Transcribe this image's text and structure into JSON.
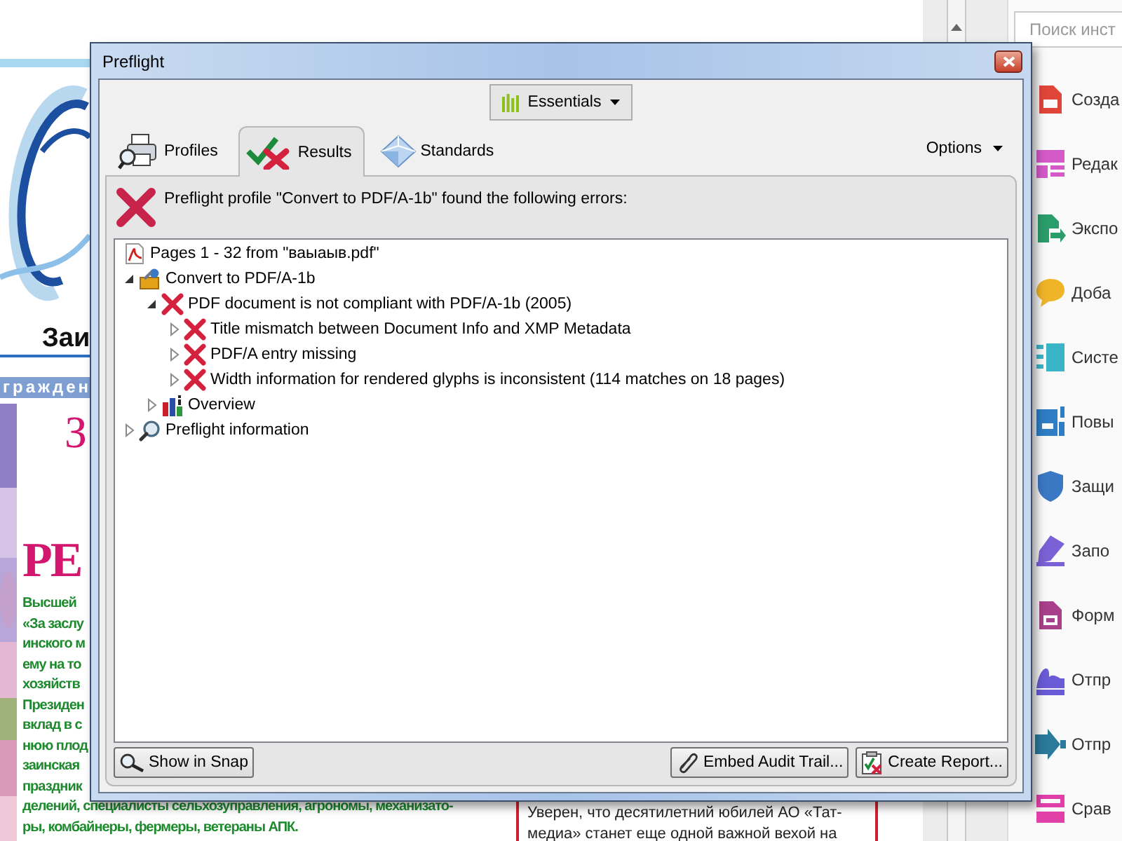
{
  "window": {
    "title": "Preflight"
  },
  "toolbar": {
    "profile_button": "Essentials"
  },
  "tabs": [
    {
      "label": "Profiles",
      "kind": "profiles",
      "selected": false
    },
    {
      "label": "Results",
      "kind": "results",
      "selected": true
    },
    {
      "label": "Standards",
      "kind": "standards",
      "selected": false
    }
  ],
  "options_menu": "Options",
  "results": {
    "message": "Preflight profile \"Convert to PDF/A-1b\" found the following errors:",
    "tree": [
      {
        "label": "Pages 1 - 32 from \"ваыаыв.pdf\"",
        "kind": "pdf"
      },
      {
        "label": "Convert to PDF/A-1b",
        "kind": "profile",
        "expanded": true,
        "children": [
          {
            "label": "PDF document is not compliant with PDF/A-1b (2005)",
            "kind": "error",
            "expanded": true,
            "children": [
              {
                "label": "Title mismatch between Document Info and XMP Metadata",
                "kind": "error",
                "expanded": false
              },
              {
                "label": "PDF/A entry missing",
                "kind": "error",
                "expanded": false
              },
              {
                "label": "Width information for rendered glyphs is inconsistent (114 matches on 18 pages)",
                "kind": "error",
                "expanded": false
              }
            ]
          },
          {
            "label": "Overview",
            "kind": "overview",
            "expanded": false
          }
        ]
      },
      {
        "label": "Preflight information",
        "kind": "info",
        "expanded": false
      }
    ]
  },
  "buttons": [
    {
      "label": "Show in Snap",
      "kind": "snap"
    },
    {
      "label": "Embed Audit Trail...",
      "kind": "embed"
    },
    {
      "label": "Create Report...",
      "kind": "report"
    }
  ],
  "document": {
    "caption": "Заи",
    "banner": "гражден",
    "heading_1": "З",
    "heading_2": "РЕ",
    "text_lines": [
      "Высшей",
      "«За заслу",
      "инского м",
      "ему на то",
      "хозяйств",
      "Президен",
      "вклад в с",
      "нюю плод",
      "заинская",
      "праздник",
      "делений, специалисты сельхозуправления, агрономы, механизато-",
      "ры, комбайнеры, фермеры, ветераны АПК."
    ],
    "box_lines": [
      "Уверен, что десятилетний юбилей АО «Тат-",
      "медиа» станет еще одной важной вехой на"
    ]
  },
  "tools_pane": {
    "search": {
      "placeholder": "Поиск инст"
    },
    "items": [
      {
        "label": "Созда",
        "kind": "create",
        "color": "#e0453a"
      },
      {
        "label": "Редак",
        "kind": "edit",
        "color": "#d35ac8"
      },
      {
        "label": "Экспо",
        "kind": "export",
        "color": "#2a9d6a"
      },
      {
        "label": "Доба",
        "kind": "comment",
        "color": "#f0b429"
      },
      {
        "label": "Систе",
        "kind": "organize",
        "color": "#3ab5c8"
      },
      {
        "label": "Повы",
        "kind": "enhance",
        "color": "#2d7ec4"
      },
      {
        "label": "Защи",
        "kind": "protect",
        "color": "#3b78c4"
      },
      {
        "label": "Запо",
        "kind": "fill",
        "color": "#7b61d6"
      },
      {
        "label": "Форм",
        "kind": "form",
        "color": "#a8408a"
      },
      {
        "label": "Отпр",
        "kind": "sign",
        "color": "#6a5bd6"
      },
      {
        "label": "Отпр",
        "kind": "send",
        "color": "#2b7a9c"
      },
      {
        "label": "Срав",
        "kind": "compare",
        "color": "#e040a8"
      }
    ]
  }
}
